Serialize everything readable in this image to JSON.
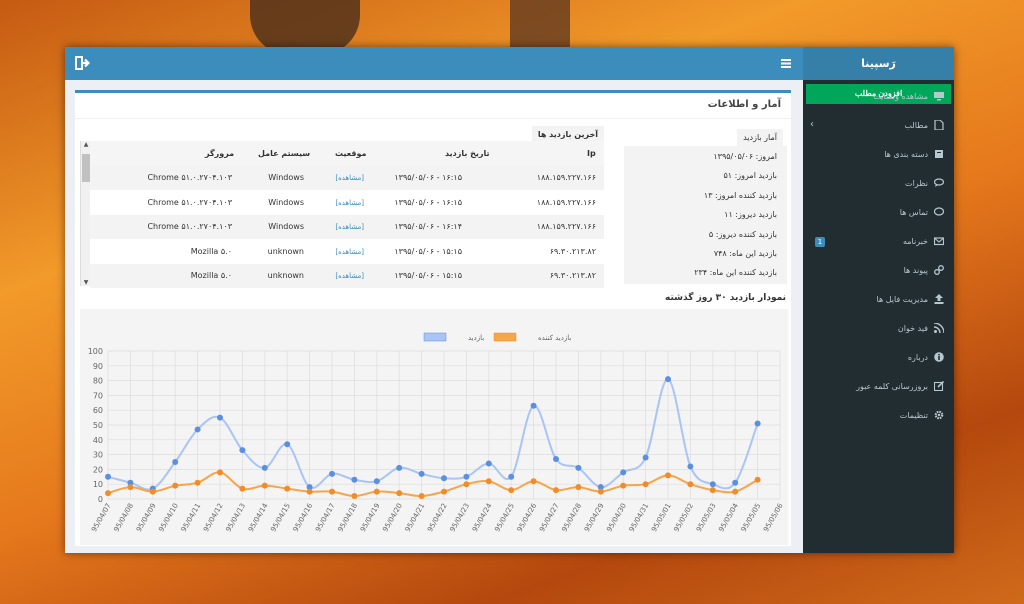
{
  "app": {
    "logo": "رَسپینا"
  },
  "sidebar": {
    "add_post": "افزودن مطلب",
    "items": [
      {
        "label": "مشاهده وبسایت",
        "icon": "monitor-icon"
      },
      {
        "label": "مطالب",
        "icon": "file-icon"
      },
      {
        "label": "دسته بندی ها",
        "icon": "book-icon"
      },
      {
        "label": "نظرات",
        "icon": "comments-icon"
      },
      {
        "label": "تماس ها",
        "icon": "chat-icon"
      },
      {
        "label": "خبرنامه",
        "icon": "envelope-icon",
        "badge": "1"
      },
      {
        "label": "پیوند ها",
        "icon": "link-icon"
      },
      {
        "label": "مدیریت فایل ها",
        "icon": "upload-icon"
      },
      {
        "label": "فید خوان",
        "icon": "rss-icon"
      },
      {
        "label": "درباره",
        "icon": "info-icon"
      },
      {
        "label": "بروزرسانی کلمه عبور",
        "icon": "edit-icon"
      },
      {
        "label": "تنظیمات",
        "icon": "gear-icon"
      }
    ]
  },
  "main": {
    "title": "آمار و اطلاعات"
  },
  "stats": {
    "title": "آمار بازدید",
    "lines": [
      "امروز: ۱۳۹۵/۰۵/۰۶",
      "بازدید امروز: ۵۱",
      "بازدید کننده امروز: ۱۳",
      "بازدید دیروز: ۱۱",
      "بازدید کننده دیروز: ۵",
      "بازدید این ماه: ۷۴۸",
      "بازدید کننده این ماه: ۲۳۴"
    ]
  },
  "visits": {
    "title": "آخرین بازدید ها",
    "headers": {
      "ip": "Ip",
      "date": "تاریخ بازدید",
      "position": "موقعیت",
      "os": "سیستم عامل",
      "browser": "مرورگر"
    },
    "rows": [
      {
        "ip": "۱۸۸.۱۵۹.۲۲۷.۱۶۶",
        "date": "۱۳۹۵/۰۵/۰۶ - ۱۶:۱۵",
        "position": "[مشاهده]",
        "os": "Windows",
        "browser": "Chrome ۵۱.۰.۲۷۰۴.۱۰۳"
      },
      {
        "ip": "۱۸۸.۱۵۹.۲۲۷.۱۶۶",
        "date": "۱۳۹۵/۰۵/۰۶ - ۱۶:۱۵",
        "position": "[مشاهده]",
        "os": "Windows",
        "browser": "Chrome ۵۱.۰.۲۷۰۴.۱۰۳"
      },
      {
        "ip": "۱۸۸.۱۵۹.۲۲۷.۱۶۶",
        "date": "۱۳۹۵/۰۵/۰۶ - ۱۶:۱۴",
        "position": "[مشاهده]",
        "os": "Windows",
        "browser": "Chrome ۵۱.۰.۲۷۰۴.۱۰۳"
      },
      {
        "ip": "۶۹.۳۰.۲۱۳.۸۲",
        "date": "۱۳۹۵/۰۵/۰۶ - ۱۵:۱۵",
        "position": "[مشاهده]",
        "os": "unknown",
        "browser": "Mozilla ۵.۰"
      },
      {
        "ip": "۶۹.۳۰.۲۱۳.۸۲",
        "date": "۱۳۹۵/۰۵/۰۶ - ۱۵:۱۵",
        "position": "[مشاهده]",
        "os": "unknown",
        "browser": "Mozilla ۵.۰"
      }
    ]
  },
  "chart_title": "نمودار بازدید ۳۰ روز گذشته",
  "colors": {
    "topbar": "#3c8dbc",
    "sidebar": "#222d32",
    "add_button": "#00a65a",
    "series_visits": "#a9c4f5",
    "series_visitors": "#f7a54a"
  },
  "chart_data": {
    "type": "line",
    "categories": [
      "95/04/07",
      "95/04/08",
      "95/04/09",
      "95/04/10",
      "95/04/11",
      "95/04/12",
      "95/04/13",
      "95/04/14",
      "95/04/15",
      "95/04/16",
      "95/04/17",
      "95/04/18",
      "95/04/19",
      "95/04/20",
      "95/04/21",
      "95/04/22",
      "95/04/23",
      "95/04/24",
      "95/04/25",
      "95/04/26",
      "95/04/27",
      "95/04/28",
      "95/04/29",
      "95/04/30",
      "95/04/31",
      "95/05/01",
      "95/05/02",
      "95/05/03",
      "95/05/04",
      "95/05/05",
      "95/05/06"
    ],
    "series": [
      {
        "name": "بازدید",
        "color": "#a9c4f5",
        "point_color": "#5b8fe0",
        "values": [
          15,
          11,
          7,
          25,
          47,
          55,
          33,
          21,
          37,
          8,
          17,
          13,
          12,
          21,
          17,
          14,
          15,
          24,
          15,
          63,
          27,
          21,
          8,
          18,
          28,
          81,
          22,
          10,
          11,
          51
        ]
      },
      {
        "name": "بازدید کننده",
        "color": "#f7a54a",
        "point_color": "#f28c28",
        "values": [
          4,
          8,
          5,
          9,
          11,
          18,
          7,
          9,
          7,
          5,
          5,
          2,
          5,
          4,
          2,
          5,
          10,
          12,
          6,
          12,
          6,
          8,
          5,
          9,
          10,
          16,
          10,
          6,
          5,
          13
        ]
      }
    ],
    "ylim": [
      0,
      100
    ],
    "yticks": [
      0,
      10,
      20,
      30,
      40,
      50,
      60,
      70,
      80,
      90,
      100
    ],
    "grid": true,
    "legend": "top-center"
  }
}
